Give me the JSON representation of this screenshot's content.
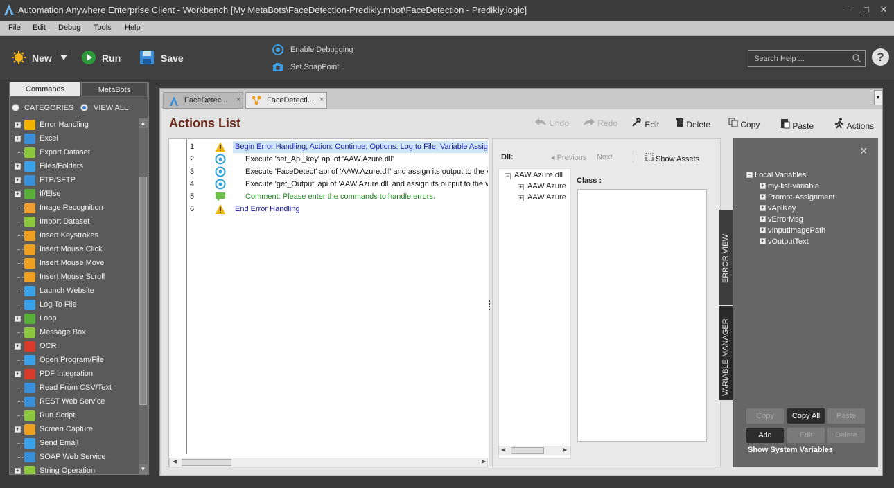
{
  "window": {
    "title": "Automation Anywhere Enterprise Client  - Workbench [My MetaBots\\FaceDetection-Predikly.mbot\\FaceDetection - Predikly.logic]",
    "minimize": "–",
    "maximize": "□",
    "close": "✕"
  },
  "menu": [
    "File",
    "Edit",
    "Debug",
    "Tools",
    "Help"
  ],
  "toolbar": {
    "new_label": "New",
    "run_label": "Run",
    "save_label": "Save",
    "enable_debugging": "Enable Debugging",
    "set_snappoint": "Set SnapPoint",
    "search_placeholder": "Search Help ...",
    "help": "?"
  },
  "left_panel": {
    "tabs": [
      "Commands",
      "MetaBots"
    ],
    "active_tab": "Commands",
    "radio_categories": "CATEGORIES",
    "radio_view_all": "VIEW ALL",
    "commands": [
      {
        "label": "Error Handling",
        "expandable": true,
        "icon": "warning-icon",
        "color": "#f0b400"
      },
      {
        "label": "Excel",
        "expandable": true,
        "icon": "excel-icon",
        "color": "#3a8fd8"
      },
      {
        "label": "Export Dataset",
        "expandable": false,
        "icon": "dataset-icon",
        "color": "#8dc63f"
      },
      {
        "label": "Files/Folders",
        "expandable": true,
        "icon": "folder-icon",
        "color": "#3aa0e8"
      },
      {
        "label": "FTP/SFTP",
        "expandable": true,
        "icon": "ftp-icon",
        "color": "#3a8fd8"
      },
      {
        "label": "If/Else",
        "expandable": true,
        "icon": "ifelse-icon",
        "color": "#5aae3a"
      },
      {
        "label": "Image Recognition",
        "expandable": false,
        "icon": "image-recognition-icon",
        "color": "#f0a030"
      },
      {
        "label": "Import Dataset",
        "expandable": false,
        "icon": "dataset-icon",
        "color": "#8dc63f"
      },
      {
        "label": "Insert Keystrokes",
        "expandable": false,
        "icon": "keystrokes-icon",
        "color": "#f0a020"
      },
      {
        "label": "Insert Mouse Click",
        "expandable": false,
        "icon": "mouse-click-icon",
        "color": "#f0a020"
      },
      {
        "label": "Insert Mouse Move",
        "expandable": false,
        "icon": "mouse-move-icon",
        "color": "#f0a020"
      },
      {
        "label": "Insert Mouse Scroll",
        "expandable": false,
        "icon": "mouse-scroll-icon",
        "color": "#f0a020"
      },
      {
        "label": "Launch Website",
        "expandable": false,
        "icon": "website-icon",
        "color": "#3aa0e8"
      },
      {
        "label": "Log To File",
        "expandable": false,
        "icon": "log-icon",
        "color": "#3aa0e8"
      },
      {
        "label": "Loop",
        "expandable": true,
        "icon": "loop-icon",
        "color": "#5aae3a"
      },
      {
        "label": "Message Box",
        "expandable": false,
        "icon": "message-box-icon",
        "color": "#8dc63f"
      },
      {
        "label": "OCR",
        "expandable": true,
        "icon": "ocr-icon",
        "color": "#d83a2a"
      },
      {
        "label": "Open Program/File",
        "expandable": false,
        "icon": "open-program-icon",
        "color": "#3aa0e8"
      },
      {
        "label": "PDF Integration",
        "expandable": true,
        "icon": "pdf-icon",
        "color": "#d83a2a"
      },
      {
        "label": "Read From CSV/Text",
        "expandable": false,
        "icon": "csv-icon",
        "color": "#3a8fd8"
      },
      {
        "label": "REST Web Service",
        "expandable": false,
        "icon": "rest-icon",
        "color": "#3a8fd8"
      },
      {
        "label": "Run Script",
        "expandable": false,
        "icon": "script-icon",
        "color": "#8dc63f"
      },
      {
        "label": "Screen Capture",
        "expandable": true,
        "icon": "camera-icon",
        "color": "#f0a020"
      },
      {
        "label": "Send Email",
        "expandable": false,
        "icon": "email-icon",
        "color": "#3aa0e8"
      },
      {
        "label": "SOAP Web Service",
        "expandable": false,
        "icon": "soap-icon",
        "color": "#3a8fd8"
      },
      {
        "label": "String Operation",
        "expandable": true,
        "icon": "string-icon",
        "color": "#8dc63f"
      }
    ]
  },
  "doc_tabs": [
    {
      "label": "FaceDetec...",
      "close": "×",
      "active": false
    },
    {
      "label": "FaceDetecti...",
      "close": "×",
      "active": true
    }
  ],
  "actions_bar": {
    "title": "Actions List",
    "undo": "Undo",
    "redo": "Redo",
    "edit": "Edit",
    "delete": "Delete",
    "copy": "Copy",
    "paste": "Paste",
    "actions": "Actions"
  },
  "script_lines": [
    {
      "num": "1",
      "icon": "warning-icon",
      "indent": 0,
      "color": "#1a1aa8",
      "text": "Begin Error Handling; Action: Continue; Options: Log to File, Variable Assignment",
      "selected": true
    },
    {
      "num": "2",
      "icon": "metabot-icon",
      "indent": 1,
      "color": "#111111",
      "text": "Execute 'set_Api_key' api of 'AAW.Azure.dll'",
      "selected": false
    },
    {
      "num": "3",
      "icon": "metabot-icon",
      "indent": 1,
      "color": "#111111",
      "text": "Execute 'FaceDetect' api of 'AAW.Azure.dll' and assign its output to the variable",
      "selected": false
    },
    {
      "num": "4",
      "icon": "metabot-icon",
      "indent": 1,
      "color": "#111111",
      "text": "Execute 'get_Output' api of 'AAW.Azure.dll' and assign its output to the variable",
      "selected": false
    },
    {
      "num": "5",
      "icon": "comment-icon",
      "indent": 1,
      "color": "#1a8a1a",
      "text": "Comment: Please enter the commands to handle errors.",
      "selected": false
    },
    {
      "num": "6",
      "icon": "warning-icon",
      "indent": 0,
      "color": "#1a1aa8",
      "text": "End Error Handling",
      "selected": false
    }
  ],
  "dll_panel": {
    "dll_label": "Dll:",
    "previous": "Previous",
    "next": "Next",
    "show_assets": "Show Assets",
    "class_label": "Class :",
    "tree_root": "AAW.Azure.dll",
    "tree_children": [
      "AAW.Azure",
      "AAW.Azure"
    ]
  },
  "side_tabs": {
    "error_view": "ERROR VIEW",
    "variable_manager": "VARIABLE MANAGER"
  },
  "variables": {
    "root": "Local Variables",
    "items": [
      "my-list-variable",
      "Prompt-Assignment",
      "vApiKey",
      "vErrorMsg",
      "vInputImagePath",
      "vOutputText"
    ],
    "buttons": {
      "copy": "Copy",
      "copy_all": "Copy All",
      "paste": "Paste",
      "add": "Add",
      "edit": "Edit",
      "delete": "Delete"
    },
    "show_system": "Show System Variables",
    "close": "×"
  }
}
